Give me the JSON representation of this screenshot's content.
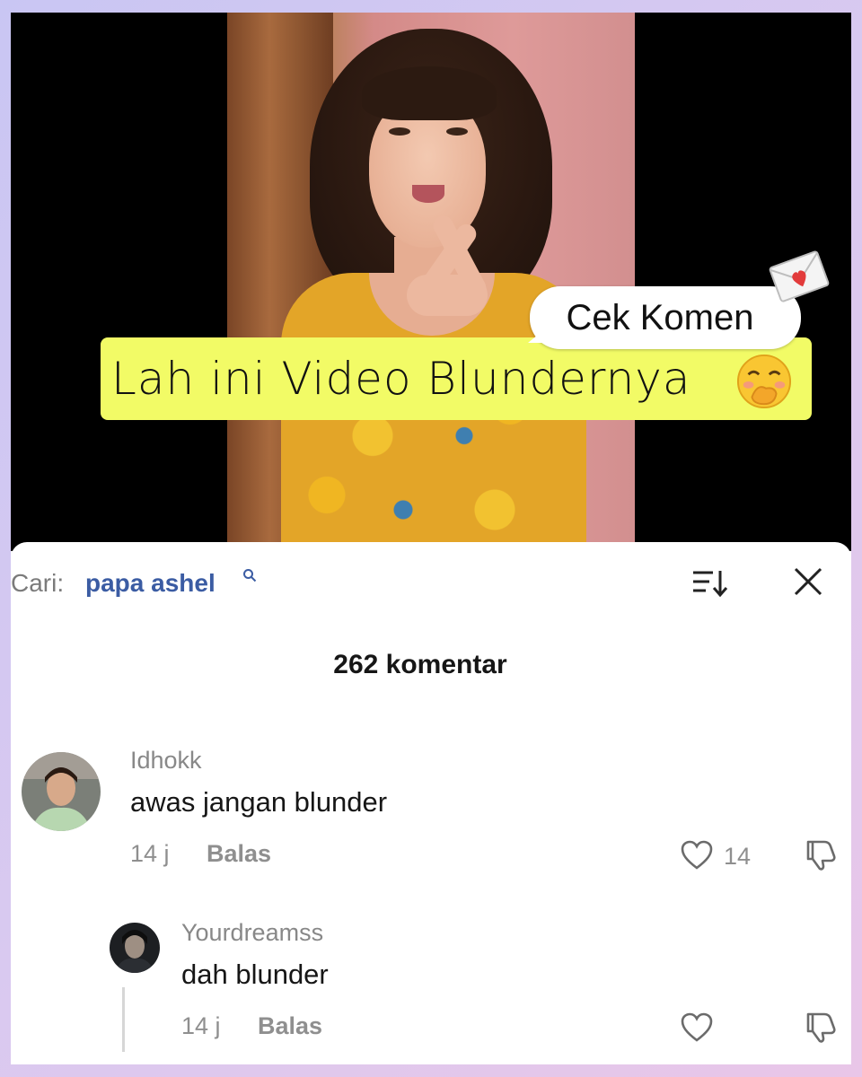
{
  "video": {
    "bubble_text": "Cek Komen",
    "banner_text": "Lah ini Video Blundernya",
    "banner_color": "#f2fb66",
    "emoji": "face-with-hand-over-mouth-emoji",
    "sticker": "love-letter-icon"
  },
  "comments_panel": {
    "search_label": "Cari:",
    "search_query": "papa ashel",
    "count_label": "262 komentar",
    "icons": [
      "search-icon",
      "sort-icon",
      "close-icon"
    ],
    "accent_color": "#3b5ca3"
  },
  "comments": [
    {
      "username": "Idhokk",
      "text": "awas jangan blunder",
      "time": "14 j",
      "reply_label": "Balas",
      "likes": "14"
    },
    {
      "username": "Yourdreamss",
      "text": "dah blunder",
      "time": "14 j",
      "reply_label": "Balas",
      "likes": ""
    }
  ]
}
